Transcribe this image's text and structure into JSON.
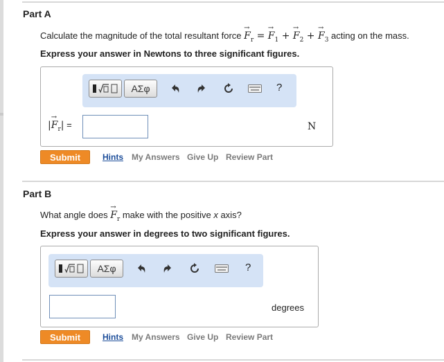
{
  "partA": {
    "title": "Part A",
    "question_prefix": "Calculate the magnitude of the total resultant force ",
    "question_suffix": " acting on the mass.",
    "instruction": "Express your answer in Newtons to three significant figures.",
    "input_label_eq": " =",
    "input_value": "",
    "unit": "N",
    "actions": {
      "submit": "Submit",
      "hints": "Hints",
      "my_answers": "My Answers",
      "give_up": "Give Up",
      "review": "Review Part"
    }
  },
  "partB": {
    "title": "Part B",
    "question_prefix": "What angle does ",
    "question_mid": " make with the positive ",
    "question_var": "x",
    "question_suffix": " axis?",
    "instruction": "Express your answer in degrees to two significant figures.",
    "input_value": "",
    "unit": "degrees",
    "actions": {
      "submit": "Submit",
      "hints": "Hints",
      "my_answers": "My Answers",
      "give_up": "Give Up",
      "review": "Review Part"
    }
  },
  "toolbar": {
    "greek_label": "ΑΣφ",
    "help_label": "?",
    "icons": [
      "templates-icon",
      "greek-letters-icon",
      "undo-icon",
      "redo-icon",
      "reset-icon",
      "keyboard-icon",
      "help-icon"
    ]
  },
  "colors": {
    "submit": "#ee8a26",
    "toolbar_bg": "#d5e3f6",
    "hints_link": "#1d4e9a",
    "input_border": "#6f8fb8"
  }
}
